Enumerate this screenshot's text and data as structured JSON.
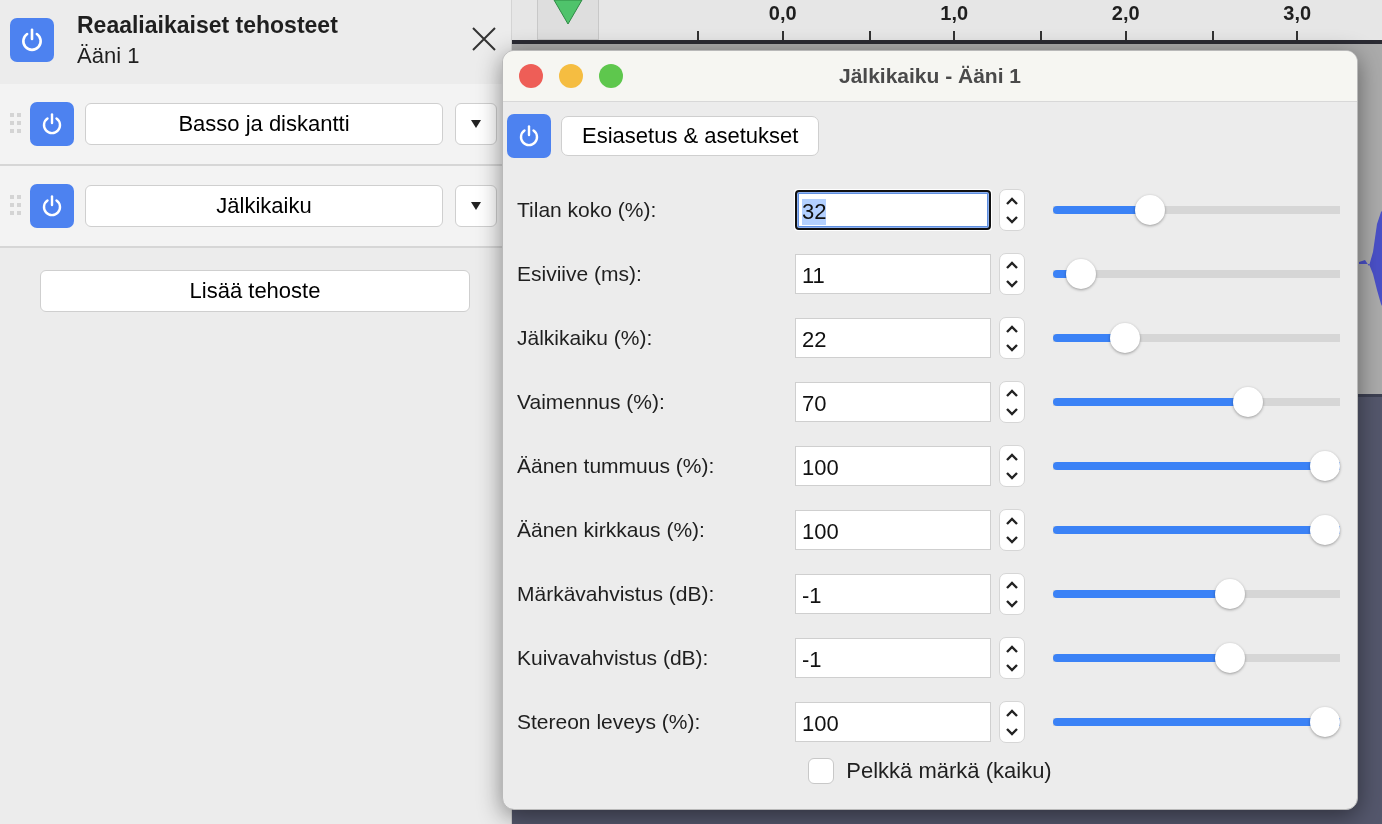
{
  "panel": {
    "title": "Reaaliaikaiset tehosteet",
    "subtitle": "Ääni 1",
    "enabled": true,
    "effects": [
      {
        "name": "Basso ja diskantti",
        "enabled": true
      },
      {
        "name": "Jälkikaiku",
        "enabled": true
      }
    ],
    "add_button": "Lisää tehoste"
  },
  "ruler": {
    "labels": [
      "0,0",
      "1,0",
      "2,0",
      "3,0"
    ]
  },
  "dialog": {
    "title": "Jälkikaiku - Ääni 1",
    "enabled": true,
    "preset_button": "Esiasetus & asetukset",
    "params": [
      {
        "label": "Tilan koko (%):",
        "value": "32",
        "level": 0.32,
        "focused": true
      },
      {
        "label": "Esiviive (ms):",
        "value": "11",
        "level": 0.05,
        "focused": false
      },
      {
        "label": "Jälkikaiku (%):",
        "value": "22",
        "level": 0.22,
        "focused": false
      },
      {
        "label": "Vaimennus (%):",
        "value": "70",
        "level": 0.7,
        "focused": false
      },
      {
        "label": "Äänen tummuus (%):",
        "value": "100",
        "level": 1,
        "focused": false
      },
      {
        "label": "Äänen kirkkaus (%):",
        "value": "100",
        "level": 1,
        "focused": false
      },
      {
        "label": "Märkävahvistus (dB):",
        "value": "-1",
        "level": 0.63,
        "focused": false
      },
      {
        "label": "Kuivavahvistus (dB):",
        "value": "-1",
        "level": 0.63,
        "focused": false
      },
      {
        "label": "Stereon leveys (%):",
        "value": "100",
        "level": 1,
        "focused": false
      }
    ],
    "wet_only": {
      "label": "Pelkkä märkä (kaiku)",
      "checked": false
    }
  }
}
